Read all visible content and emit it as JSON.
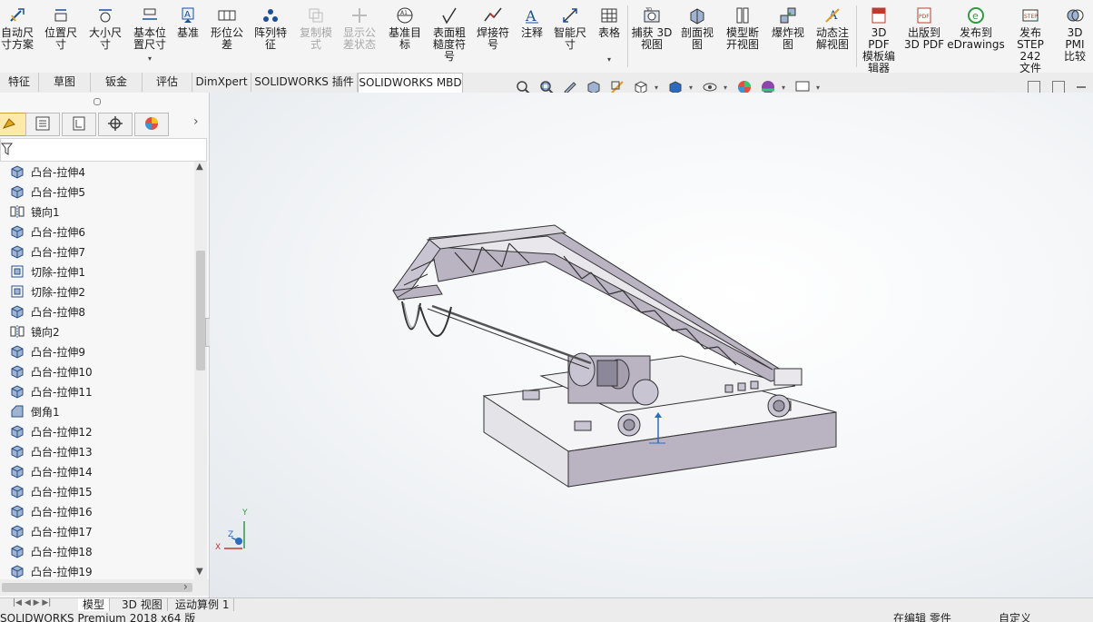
{
  "ribbon": {
    "buttons": [
      {
        "label": "自动尺\n寸方案",
        "icon": "auto-dimension-icon",
        "enabled": true
      },
      {
        "label": "位置尺\n寸",
        "icon": "location-dimension-icon",
        "enabled": true
      },
      {
        "label": "大小尺\n寸",
        "icon": "size-dimension-icon",
        "enabled": true
      },
      {
        "label": "基本位\n置尺寸",
        "icon": "basic-location-dimension-icon",
        "enabled": true
      },
      {
        "label": "基准",
        "icon": "datum-icon",
        "enabled": true
      },
      {
        "label": "形位公\n差",
        "icon": "geometric-tolerance-icon",
        "enabled": true
      },
      {
        "label": "阵列特\n征",
        "icon": "pattern-feature-icon",
        "enabled": true
      },
      {
        "label": "复制模\n式",
        "icon": "copy-scheme-icon",
        "enabled": false
      },
      {
        "label": "显示公\n差状态",
        "icon": "show-tolerance-status-icon",
        "enabled": false
      },
      {
        "label": "基准目\n标",
        "icon": "datum-target-icon",
        "enabled": true
      },
      {
        "label": "表面粗\n糙度符\n号",
        "icon": "surface-finish-icon",
        "enabled": true
      },
      {
        "label": "焊接符\n号",
        "icon": "weld-symbol-icon",
        "enabled": true
      },
      {
        "label": "注释",
        "icon": "note-icon",
        "enabled": true
      },
      {
        "label": "智能尺\n寸",
        "icon": "smart-dimension-icon",
        "enabled": true
      },
      {
        "label": "表格",
        "icon": "table-icon",
        "enabled": true
      },
      {
        "label": "捕获 3D\n视图",
        "icon": "capture-3d-view-icon",
        "enabled": true
      },
      {
        "label": "剖面视\n图",
        "icon": "section-view-icon",
        "enabled": true
      },
      {
        "label": "模型断\n开视图",
        "icon": "model-break-view-icon",
        "enabled": true
      },
      {
        "label": "爆炸视\n图",
        "icon": "exploded-view-icon",
        "enabled": true
      },
      {
        "label": "动态注\n解视图",
        "icon": "dynamic-annotation-view-icon",
        "enabled": true
      },
      {
        "label": "3D PDF\n模板编\n辑器",
        "icon": "3d-pdf-template-editor-icon",
        "enabled": true
      },
      {
        "label": "出版到\n3D PDF",
        "icon": "publish-3d-pdf-icon",
        "enabled": true
      },
      {
        "label": "发布到\neDrawings",
        "icon": "edrawings-icon",
        "enabled": true
      },
      {
        "label": "发布\nSTEP 242\n文件",
        "icon": "step-242-icon",
        "enabled": true
      },
      {
        "label": "3D PMI\n比较",
        "icon": "3d-pmi-compare-icon",
        "enabled": true
      }
    ]
  },
  "tabs": [
    "特征",
    "草图",
    "钣金",
    "评估",
    "DimXpert",
    "SOLIDWORKS 插件",
    "SOLIDWORKS MBD"
  ],
  "tree": {
    "items": [
      {
        "label": "凸台-拉伸4",
        "type": "extrude"
      },
      {
        "label": "凸台-拉伸5",
        "type": "extrude"
      },
      {
        "label": "镜向1",
        "type": "mirror"
      },
      {
        "label": "凸台-拉伸6",
        "type": "extrude"
      },
      {
        "label": "凸台-拉伸7",
        "type": "extrude"
      },
      {
        "label": "切除-拉伸1",
        "type": "cut"
      },
      {
        "label": "切除-拉伸2",
        "type": "cut"
      },
      {
        "label": "凸台-拉伸8",
        "type": "extrude"
      },
      {
        "label": "镜向2",
        "type": "mirror"
      },
      {
        "label": "凸台-拉伸9",
        "type": "extrude"
      },
      {
        "label": "凸台-拉伸10",
        "type": "extrude"
      },
      {
        "label": "凸台-拉伸11",
        "type": "extrude"
      },
      {
        "label": "倒角1",
        "type": "chamfer"
      },
      {
        "label": "凸台-拉伸12",
        "type": "extrude"
      },
      {
        "label": "凸台-拉伸13",
        "type": "extrude"
      },
      {
        "label": "凸台-拉伸14",
        "type": "extrude"
      },
      {
        "label": "凸台-拉伸15",
        "type": "extrude"
      },
      {
        "label": "凸台-拉伸16",
        "type": "extrude"
      },
      {
        "label": "凸台-拉伸17",
        "type": "extrude"
      },
      {
        "label": "凸台-拉伸18",
        "type": "extrude"
      },
      {
        "label": "凸台-拉伸19",
        "type": "extrude"
      }
    ]
  },
  "bottom_tabs": [
    "模型",
    "3D 视图",
    "运动算例 1"
  ],
  "status": {
    "left": "SOLIDWORKS Premium 2018 x64 版",
    "middle": "在编辑 零件",
    "right": "自定义"
  },
  "triad": {
    "x": "X",
    "y": "Y",
    "z": "Z"
  },
  "colors": {
    "model": "#b9b3c2",
    "accent": "#2a6cc4",
    "tab_active": "#ffffff"
  }
}
